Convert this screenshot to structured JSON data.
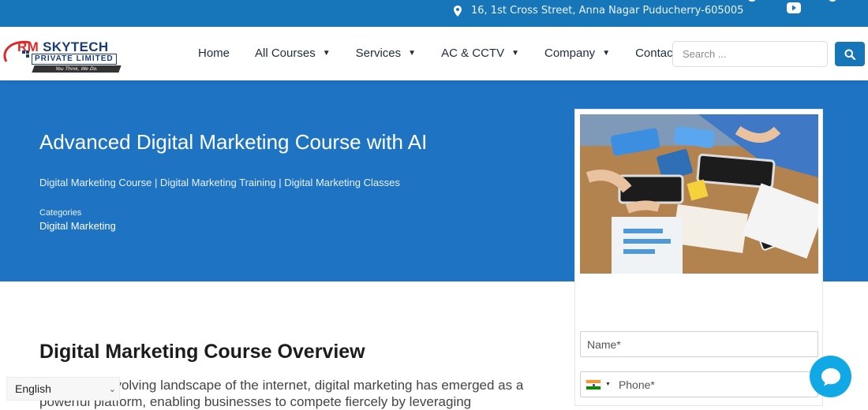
{
  "topbar": {
    "address": "16, 1st Cross Street, Anna Nagar Puducherry-605005",
    "icons": [
      "location-pin-icon",
      "youtube-icon"
    ],
    "bg_color": "#1776b8"
  },
  "logo": {
    "line1_prefix": "RM",
    "line1_rest": " SKYTECH",
    "line2": "PRIVATE LIMITED",
    "tagline": "You Think, We Do."
  },
  "nav": {
    "items": [
      {
        "label": "Home",
        "dropdown": false
      },
      {
        "label": "All Courses",
        "dropdown": true
      },
      {
        "label": "Services",
        "dropdown": true
      },
      {
        "label": "AC & CCTV",
        "dropdown": true
      },
      {
        "label": "Company",
        "dropdown": true
      },
      {
        "label": "Contact",
        "dropdown": false
      }
    ],
    "search_placeholder": "Search ...",
    "search_icon": "search-icon"
  },
  "hero": {
    "title": "Advanced Digital Marketing Course with AI",
    "subtitle": "Digital Marketing Course | Digital Marketing Training | Digital Marketing Classes",
    "categories_label": "Categories",
    "category_value": "Digital Marketing",
    "bg_color": "#1e73c3"
  },
  "form": {
    "name_placeholder": "Name*",
    "phone_placeholder": "Phone*",
    "country_flag": "india-flag-icon"
  },
  "content": {
    "title": "Digital Marketing Course Overview",
    "paragraph": "In the ever-evolving landscape of the internet, digital marketing has emerged as a powerful platform, enabling businesses to compete fiercely by leveraging"
  },
  "language": {
    "selected": "English"
  },
  "chat": {
    "icon": "chat-bubble-icon",
    "color": "#10a9e6"
  }
}
